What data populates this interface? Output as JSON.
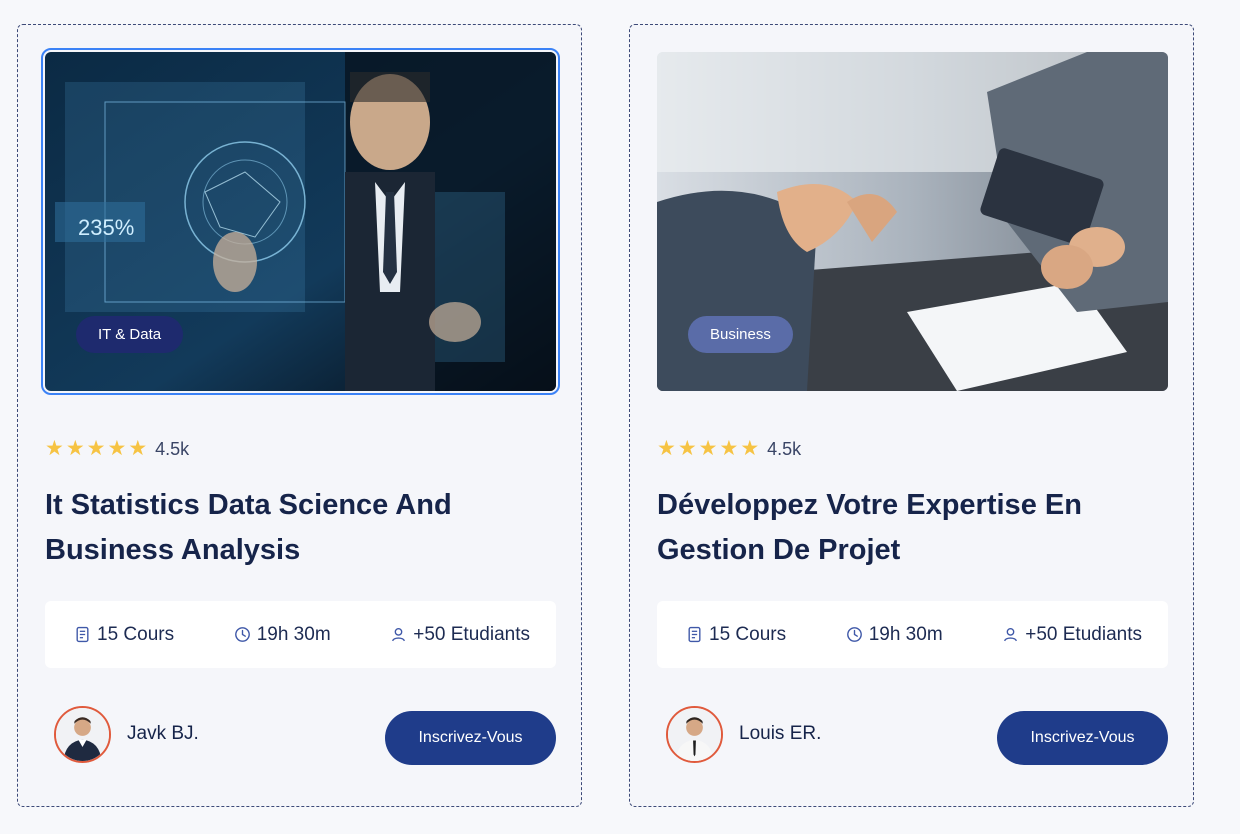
{
  "cards": [
    {
      "category": "IT & Data",
      "rating": "4.5k",
      "title": "It Statistics Data Science And Business Analysis",
      "stats": {
        "courses": "15 Cours",
        "duration": "19h 30m",
        "students": "+50 Etudiants"
      },
      "image_overlay_text": "235%",
      "author": "Javk BJ.",
      "cta": "Inscrivez-Vous"
    },
    {
      "category": "Business",
      "rating": "4.5k",
      "title": "Développez Votre Expertise En Gestion De Projet",
      "stats": {
        "courses": "15 Cours",
        "duration": "19h 30m",
        "students": "+50 Etudiants"
      },
      "author": "Louis ER.",
      "cta": "Inscrivez-Vous"
    }
  ],
  "icons": {
    "star": "star-icon",
    "courses": "document-icon",
    "duration": "clock-icon",
    "students": "user-icon"
  },
  "colors": {
    "accent": "#1f3c8a",
    "star": "#f6c343",
    "tag_it": "#1e2a6e",
    "tag_business": "#5a6ca8"
  }
}
